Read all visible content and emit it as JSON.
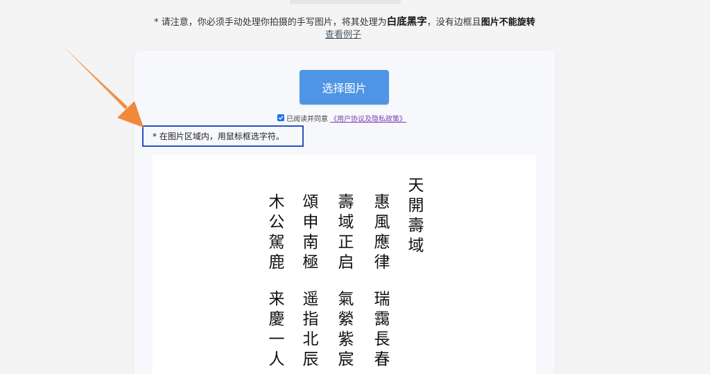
{
  "notice": {
    "prefix": "* 请注意，你必须手动处理你拍摄的手写图片，将其处理为",
    "strong": "白底黑字",
    "middle": "，没有边框且",
    "bold": "图片不能旋转",
    "example_link": "查看例子"
  },
  "upload": {
    "select_button": "选择图片",
    "agree_text": "已阅读并同意",
    "agree_link": "《用户协议及隐私政策》",
    "agree_checked": true
  },
  "hint": "* 在图片区域内，用鼠标框选字符。",
  "calligraphy": {
    "title": [
      "天",
      "開",
      "壽",
      "域"
    ],
    "couplets": [
      {
        "top": [
          "惠",
          "風",
          "應",
          "律"
        ],
        "bottom": [
          "瑞",
          "靄",
          "長",
          "春"
        ]
      },
      {
        "top": [
          "壽",
          "域",
          "正",
          "启"
        ],
        "bottom": [
          "氣",
          "縈",
          "紫",
          "宸"
        ]
      },
      {
        "top": [
          "頌",
          "申",
          "南",
          "極"
        ],
        "bottom": [
          "遥",
          "指",
          "北",
          "辰"
        ]
      },
      {
        "top": [
          "木",
          "公",
          "駕",
          "鹿"
        ],
        "bottom": [
          "来",
          "慶",
          "一",
          "人"
        ]
      }
    ]
  },
  "colors": {
    "button": "#4f95e6",
    "hint_border": "#2a4fc4",
    "arrow": "#f0893a",
    "link": "#7a3fae"
  },
  "icons": {
    "arrow": "annotation-arrow-icon",
    "checkbox": "checkbox-checked-icon"
  }
}
